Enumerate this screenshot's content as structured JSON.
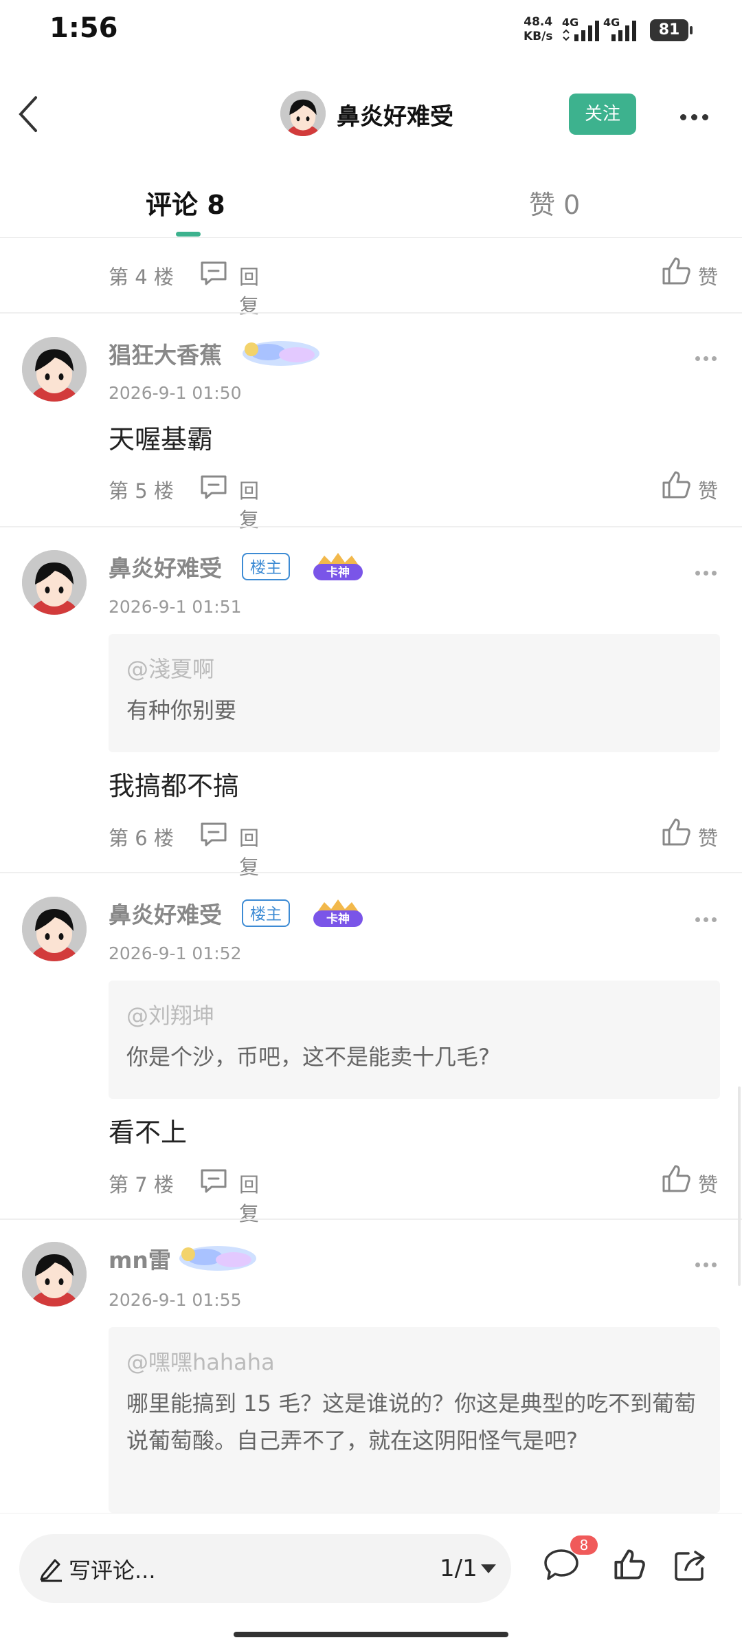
{
  "status_bar": {
    "time": "1:56",
    "net_speed": "48.4",
    "net_unit": "KB/s",
    "sig1_label": "4G",
    "sig2_label": "4G",
    "battery": "81"
  },
  "header": {
    "name": "鼻炎好难受",
    "follow_label": "关注"
  },
  "tabs": {
    "comments": "评论 8",
    "likes": "赞 0"
  },
  "floor_label": "回复",
  "like_label": "赞",
  "lz_label": "楼主",
  "medal_text": "卡神",
  "posts": [
    {
      "floor": "第 4 楼"
    },
    {
      "user": "猖狂大香蕉",
      "time": "2026-9-1 01:50",
      "text": "天喔基霸",
      "floor": "第 5 楼"
    },
    {
      "user": "鼻炎好难受",
      "time": "2026-9-1 01:51",
      "quote_at": "@淺夏啊",
      "quote_text": "有种你别要",
      "text": "我搞都不搞",
      "floor": "第 6 楼"
    },
    {
      "user": "鼻炎好难受",
      "time": "2026-9-1 01:52",
      "quote_at": "@刘翔坤",
      "quote_text": "你是个沙，币吧，这不是能卖十几毛?",
      "text": "看不上",
      "floor": "第 7 楼"
    },
    {
      "user": "mn雷",
      "time": "2026-9-1 01:55",
      "quote_at": "@嘿嘿hahaha",
      "quote_text": "哪里能搞到 15 毛？这是谁说的？你这是典型的吃不到葡萄说葡萄酸。自己弄不了，就在这阴阳怪气是吧?"
    }
  ],
  "bottom_bar": {
    "write_placeholder": "写评论...",
    "page": "1/1",
    "comment_badge": "8"
  },
  "colors": {
    "accent": "#3db28e",
    "lz_blue": "#3d8bd4",
    "badge_red": "#f05a5a"
  }
}
